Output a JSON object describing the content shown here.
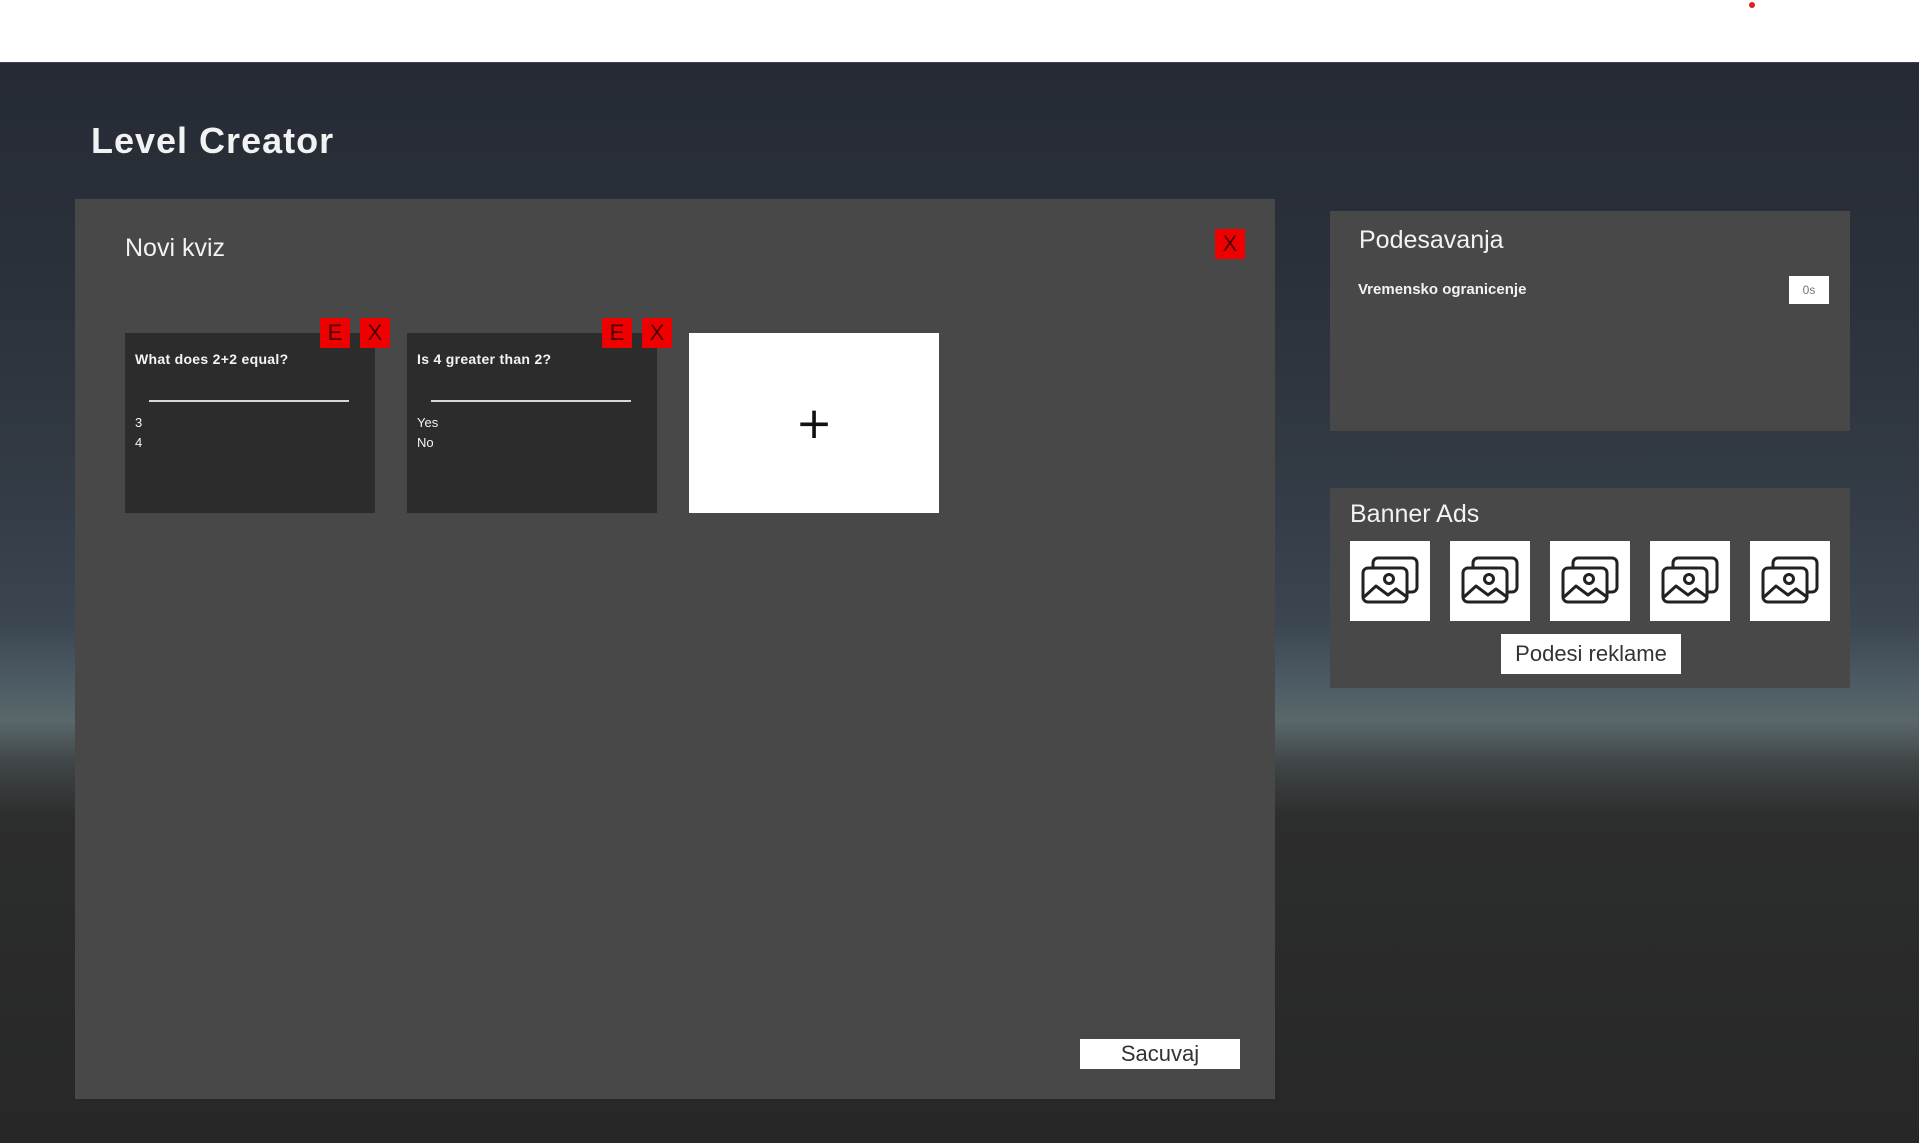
{
  "header": {
    "title": "Level Creator"
  },
  "quiz": {
    "title": "Novi kviz",
    "close_label": "X",
    "edit_label": "E",
    "delete_label": "X",
    "cards": [
      {
        "question": "What does 2+2 equal?",
        "answers": [
          "3",
          "4"
        ]
      },
      {
        "question": "Is 4 greater than 2?",
        "answers": [
          "Yes",
          "No"
        ]
      }
    ],
    "add_label": "+",
    "save_label": "Sacuvaj"
  },
  "settings": {
    "title": "Podesavanja",
    "time_limit_label": "Vremensko ogranicenje",
    "time_limit_placeholder": "0s"
  },
  "ads": {
    "title": "Banner Ads",
    "slot_icon": "image-gallery-icon",
    "configure_label": "Podesi reklame"
  },
  "colors": {
    "accent_red": "#ee0000",
    "panel_bg": "#484848",
    "card_bg": "#2c2c2c"
  }
}
